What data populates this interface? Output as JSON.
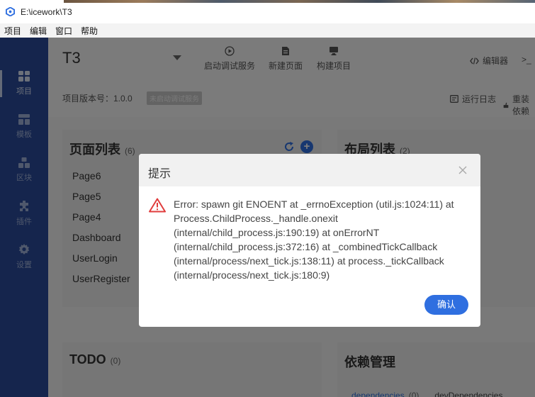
{
  "window": {
    "title": "E:\\icework\\T3"
  },
  "menu": [
    "项目",
    "编辑",
    "窗口",
    "帮助"
  ],
  "sidebar": {
    "items": [
      {
        "label": "项目",
        "icon": "grid-icon",
        "active": true
      },
      {
        "label": "模板",
        "icon": "template-icon",
        "active": false
      },
      {
        "label": "区块",
        "icon": "blocks-icon",
        "active": false
      },
      {
        "label": "插件",
        "icon": "puzzle-icon",
        "active": false
      },
      {
        "label": "设置",
        "icon": "gear-icon",
        "active": false
      }
    ]
  },
  "header": {
    "project_name": "T3",
    "toolbar": [
      "启动调试服务",
      "新建页面",
      "构建项目"
    ],
    "editor_label": "编辑器",
    "terminal_label": ">_",
    "version_label": "项目版本号：1.0.0",
    "debug_badge": "未启动调试服务",
    "log_label": "运行日志",
    "reinstall_label": "重装依赖"
  },
  "pages_panel": {
    "title": "页面列表",
    "count": "(6)",
    "items": [
      "Page6",
      "Page5",
      "Page4",
      "Dashboard",
      "UserLogin",
      "UserRegister"
    ]
  },
  "layouts_panel": {
    "title": "布局列表",
    "count": "(2)"
  },
  "todo_panel": {
    "title": "TODO",
    "count": "(0)"
  },
  "deps_panel": {
    "title": "依赖管理",
    "tab_dependencies": "dependencies",
    "tab_dependencies_count": "(0)",
    "tab_dev": "devDependencies"
  },
  "dialog": {
    "title": "提示",
    "message": "Error: spawn git ENOENT at _errnoException (util.js:1024:11) at Process.ChildProcess._handle.onexit (internal/child_process.js:190:19) at onErrorNT (internal/child_process.js:372:16) at _combinedTickCallback (internal/process/next_tick.js:138:11) at process._tickCallback (internal/process/next_tick.js:180:9)",
    "confirm_label": "确认"
  },
  "colors": {
    "sidebar": "#2a4b9a",
    "primary": "#2f6fe0",
    "warning": "#e03c3c"
  }
}
